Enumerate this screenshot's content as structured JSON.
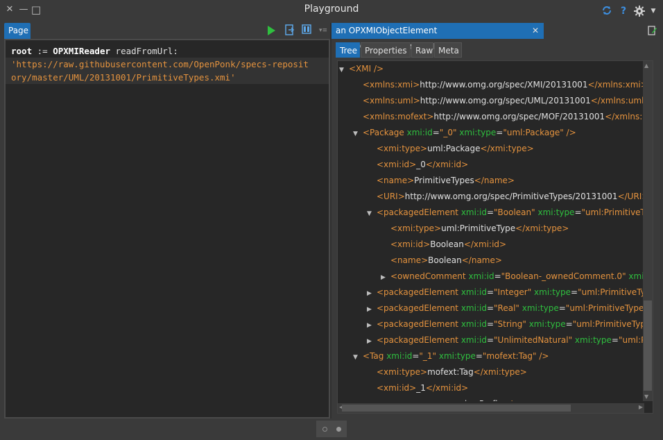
{
  "window": {
    "title": "Playground",
    "close_glyph": "✕",
    "minimize_glyph": "—",
    "maximize_glyph": "□"
  },
  "titlebar_icons": {
    "sync": "sync-icon",
    "help": "?",
    "settings": "gear-icon"
  },
  "left": {
    "tab_label": "Page",
    "code": {
      "line1_var": "root",
      "line1_assign": " := ",
      "line1_class": "OPXMIReader",
      "line1_msg": " readFromUrl:",
      "line2": "'https://raw.githubusercontent.com/OpenPonk/specs-reposit",
      "line3": "ory/master/UML/20131001/PrimitiveTypes.xmi'"
    }
  },
  "right": {
    "inspector_title": "an OPXMIObjectElement (XMIObjectElement(XMI))",
    "close_glyph": "✕",
    "subtabs": [
      "Tree",
      "Properties",
      "Raw",
      "Meta"
    ],
    "active_subtab": "Tree",
    "tree": [
      {
        "indent": 0,
        "toggle": "▼",
        "parts": [
          [
            "tg",
            "<XMI />"
          ]
        ]
      },
      {
        "indent": 1,
        "toggle": "",
        "parts": [
          [
            "tg",
            "<xmlns:xmi>"
          ],
          [
            "tx",
            "http://www.omg.org/spec/XMI/20131001"
          ],
          [
            "tg",
            "</xmlns:xmi>"
          ]
        ]
      },
      {
        "indent": 1,
        "toggle": "",
        "parts": [
          [
            "tg",
            "<xmlns:uml>"
          ],
          [
            "tx",
            "http://www.omg.org/spec/UML/20131001"
          ],
          [
            "tg",
            "</xmlns:uml>"
          ]
        ]
      },
      {
        "indent": 1,
        "toggle": "",
        "parts": [
          [
            "tg",
            "<xmlns:mofext>"
          ],
          [
            "tx",
            "http://www.omg.org/spec/MOF/20131001"
          ],
          [
            "tg",
            "</xmlns:mofext>"
          ]
        ]
      },
      {
        "indent": 1,
        "toggle": "▼",
        "parts": [
          [
            "tg",
            "<Package "
          ],
          [
            "an",
            "xmi:id"
          ],
          [
            "tx",
            "="
          ],
          [
            "av",
            "\"_0\" "
          ],
          [
            "an",
            "xmi:type"
          ],
          [
            "tx",
            "="
          ],
          [
            "av",
            "\"uml:Package\""
          ],
          [
            "tg",
            " />"
          ]
        ]
      },
      {
        "indent": 2,
        "toggle": "",
        "parts": [
          [
            "tg",
            "<xmi:type>"
          ],
          [
            "tx",
            "uml:Package"
          ],
          [
            "tg",
            "</xmi:type>"
          ]
        ]
      },
      {
        "indent": 2,
        "toggle": "",
        "parts": [
          [
            "tg",
            "<xmi:id>"
          ],
          [
            "tx",
            "_0"
          ],
          [
            "tg",
            "</xmi:id>"
          ]
        ]
      },
      {
        "indent": 2,
        "toggle": "",
        "parts": [
          [
            "tg",
            "<name>"
          ],
          [
            "tx",
            "PrimitiveTypes"
          ],
          [
            "tg",
            "</name>"
          ]
        ]
      },
      {
        "indent": 2,
        "toggle": "",
        "parts": [
          [
            "tg",
            "<URI>"
          ],
          [
            "tx",
            "http://www.omg.org/spec/PrimitiveTypes/20131001"
          ],
          [
            "tg",
            "</URI>"
          ]
        ]
      },
      {
        "indent": 2,
        "toggle": "▼",
        "parts": [
          [
            "tg",
            "<packagedElement "
          ],
          [
            "an",
            "xmi:id"
          ],
          [
            "tx",
            "="
          ],
          [
            "av",
            "\"Boolean\" "
          ],
          [
            "an",
            "xmi:type"
          ],
          [
            "tx",
            "="
          ],
          [
            "av",
            "\"uml:PrimitiveType\""
          ],
          [
            "tg",
            " />"
          ]
        ]
      },
      {
        "indent": 3,
        "toggle": "",
        "parts": [
          [
            "tg",
            "<xmi:type>"
          ],
          [
            "tx",
            "uml:PrimitiveType"
          ],
          [
            "tg",
            "</xmi:type>"
          ]
        ]
      },
      {
        "indent": 3,
        "toggle": "",
        "parts": [
          [
            "tg",
            "<xmi:id>"
          ],
          [
            "tx",
            "Boolean"
          ],
          [
            "tg",
            "</xmi:id>"
          ]
        ]
      },
      {
        "indent": 3,
        "toggle": "",
        "parts": [
          [
            "tg",
            "<name>"
          ],
          [
            "tx",
            "Boolean"
          ],
          [
            "tg",
            "</name>"
          ]
        ]
      },
      {
        "indent": 3,
        "toggle": "▶",
        "parts": [
          [
            "tg",
            "<ownedComment "
          ],
          [
            "an",
            "xmi:id"
          ],
          [
            "tx",
            "="
          ],
          [
            "av",
            "\"Boolean-_ownedComment.0\" "
          ],
          [
            "an",
            "xmi:type"
          ],
          [
            "tx",
            "="
          ]
        ]
      },
      {
        "indent": 2,
        "toggle": "▶",
        "parts": [
          [
            "tg",
            "<packagedElement "
          ],
          [
            "an",
            "xmi:id"
          ],
          [
            "tx",
            "="
          ],
          [
            "av",
            "\"Integer\" "
          ],
          [
            "an",
            "xmi:type"
          ],
          [
            "tx",
            "="
          ],
          [
            "av",
            "\"uml:PrimitiveType\""
          ],
          [
            "tg",
            " />"
          ]
        ]
      },
      {
        "indent": 2,
        "toggle": "▶",
        "parts": [
          [
            "tg",
            "<packagedElement "
          ],
          [
            "an",
            "xmi:id"
          ],
          [
            "tx",
            "="
          ],
          [
            "av",
            "\"Real\" "
          ],
          [
            "an",
            "xmi:type"
          ],
          [
            "tx",
            "="
          ],
          [
            "av",
            "\"uml:PrimitiveType\""
          ],
          [
            "tg",
            " />"
          ]
        ]
      },
      {
        "indent": 2,
        "toggle": "▶",
        "parts": [
          [
            "tg",
            "<packagedElement "
          ],
          [
            "an",
            "xmi:id"
          ],
          [
            "tx",
            "="
          ],
          [
            "av",
            "\"String\" "
          ],
          [
            "an",
            "xmi:type"
          ],
          [
            "tx",
            "="
          ],
          [
            "av",
            "\"uml:PrimitiveType\""
          ],
          [
            "tg",
            " />"
          ]
        ]
      },
      {
        "indent": 2,
        "toggle": "▶",
        "parts": [
          [
            "tg",
            "<packagedElement "
          ],
          [
            "an",
            "xmi:id"
          ],
          [
            "tx",
            "="
          ],
          [
            "av",
            "\"UnlimitedNatural\" "
          ],
          [
            "an",
            "xmi:type"
          ],
          [
            "tx",
            "="
          ],
          [
            "av",
            "\"uml:Primitiv"
          ]
        ]
      },
      {
        "indent": 1,
        "toggle": "▼",
        "parts": [
          [
            "tg",
            "<Tag "
          ],
          [
            "an",
            "xmi:id"
          ],
          [
            "tx",
            "="
          ],
          [
            "av",
            "\"_1\" "
          ],
          [
            "an",
            "xmi:type"
          ],
          [
            "tx",
            "="
          ],
          [
            "av",
            "\"mofext:Tag\""
          ],
          [
            "tg",
            " />"
          ]
        ]
      },
      {
        "indent": 2,
        "toggle": "",
        "parts": [
          [
            "tg",
            "<xmi:type>"
          ],
          [
            "tx",
            "mofext:Tag"
          ],
          [
            "tg",
            "</xmi:type>"
          ]
        ]
      },
      {
        "indent": 2,
        "toggle": "",
        "parts": [
          [
            "tg",
            "<xmi:id>"
          ],
          [
            "tx",
            "_1"
          ],
          [
            "tg",
            "</xmi:id>"
          ]
        ]
      },
      {
        "indent": 2,
        "toggle": "",
        "parts": [
          [
            "tg",
            "<name>"
          ],
          [
            "tx",
            "org.omg.xmi.nsPrefix"
          ],
          [
            "tg",
            "</name>"
          ]
        ]
      }
    ]
  },
  "colors": {
    "accent": "#1f6fb5",
    "tag": "#e5933e",
    "attr_name": "#2fbf3f",
    "play": "#2fbf3f"
  }
}
